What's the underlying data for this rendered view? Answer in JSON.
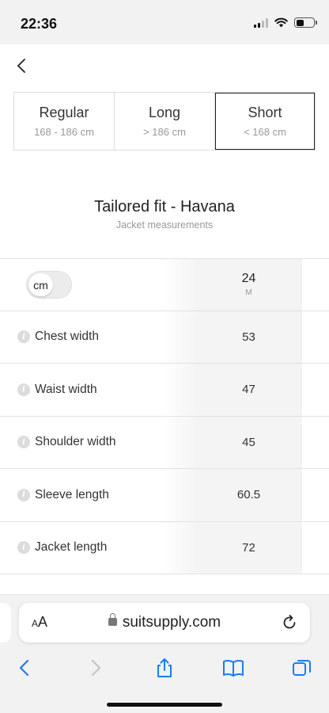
{
  "status": {
    "time": "22:36"
  },
  "lengths": [
    {
      "title": "Regular",
      "range": "168 - 186 cm",
      "selected": false
    },
    {
      "title": "Long",
      "range": "> 186 cm",
      "selected": false
    },
    {
      "title": "Short",
      "range": "< 168 cm",
      "selected": true
    }
  ],
  "fit": {
    "title": "Tailored fit - Havana",
    "subtitle": "Jacket measurements"
  },
  "unit_toggle": {
    "label": "cm"
  },
  "size": {
    "number": "24",
    "letter": "M"
  },
  "measurements": [
    {
      "label": "Chest width",
      "value": "53"
    },
    {
      "label": "Waist width",
      "value": "47"
    },
    {
      "label": "Shoulder width",
      "value": "45"
    },
    {
      "label": "Sleeve length",
      "value": "60.5"
    },
    {
      "label": "Jacket length",
      "value": "72"
    }
  ],
  "browser": {
    "text_size_label_small": "A",
    "text_size_label_large": "A",
    "url": "suitsupply.com"
  },
  "colors": {
    "accent": "#1a7cf5",
    "selected_border": "#222222",
    "value_column": "#f4f4f4"
  }
}
